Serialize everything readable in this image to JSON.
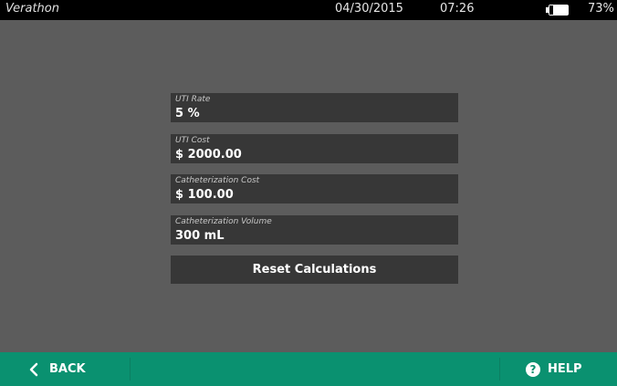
{
  "status": {
    "brand": "Verathon",
    "date": "04/30/2015",
    "time": "07:26",
    "battery": "73%"
  },
  "fields": [
    {
      "label": "UTI Rate",
      "value": "5 %"
    },
    {
      "label": "UTI Cost",
      "value": "$ 2000.00"
    },
    {
      "label": "Catheterization Cost",
      "value": "$ 100.00"
    },
    {
      "label": "Catheterization Volume",
      "value": "300 mL"
    }
  ],
  "reset_label": "Reset Calculations",
  "footer": {
    "back_label": "BACK",
    "help_label": "HELP",
    "help_icon_glyph": "?"
  },
  "colors": {
    "background": "#5c5c5c",
    "field": "#373737",
    "footer": "#0a9170"
  }
}
